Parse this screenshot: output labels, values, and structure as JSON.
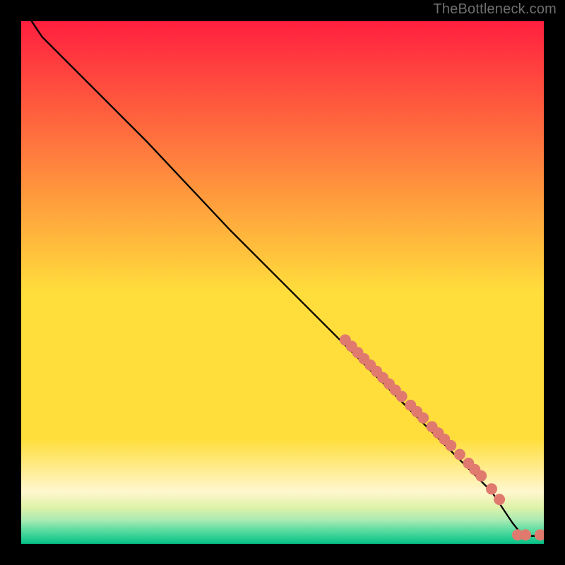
{
  "watermark": "TheBottleneck.com",
  "colors": {
    "marker": "#e07a6f",
    "curve": "#000000",
    "gradient_top": "#ff1f3f",
    "gradient_mid": "#ffde3c",
    "gradient_cream": "#fff7cf",
    "gradient_band1": "#dff2a8",
    "gradient_band2": "#a8ebb3",
    "gradient_band3": "#58dba0",
    "gradient_bottom": "#06c186"
  },
  "marker_radius": 8,
  "chart_data": {
    "type": "line",
    "title": "",
    "xlabel": "",
    "ylabel": "",
    "xlim": [
      0,
      100
    ],
    "ylim": [
      0,
      100
    ],
    "note": "Axes/tick labels not shown; values are visual estimates on a 0–100 scale where (0,100) is top-left of the colored area and (100,0) is bottom-right. Curve y decreases roughly linearly with x after an initial gentle bend. Markers are individual dots lying on or near the curve in the lower-right region.",
    "curve_points": [
      {
        "x": 2,
        "y": 100
      },
      {
        "x": 4,
        "y": 97
      },
      {
        "x": 8,
        "y": 93
      },
      {
        "x": 14,
        "y": 87
      },
      {
        "x": 24,
        "y": 77
      },
      {
        "x": 40,
        "y": 60
      },
      {
        "x": 56,
        "y": 44
      },
      {
        "x": 70,
        "y": 30
      },
      {
        "x": 82,
        "y": 18
      },
      {
        "x": 90,
        "y": 10
      },
      {
        "x": 94,
        "y": 4
      },
      {
        "x": 96,
        "y": 1.5
      },
      {
        "x": 100,
        "y": 1.5
      }
    ],
    "markers": [
      {
        "x": 62,
        "y": 39
      },
      {
        "x": 63.2,
        "y": 37.8
      },
      {
        "x": 64.4,
        "y": 36.6
      },
      {
        "x": 65.6,
        "y": 35.4
      },
      {
        "x": 66.8,
        "y": 34.2
      },
      {
        "x": 68.0,
        "y": 33.0
      },
      {
        "x": 69.2,
        "y": 31.8
      },
      {
        "x": 70.4,
        "y": 30.6
      },
      {
        "x": 71.6,
        "y": 29.4
      },
      {
        "x": 72.8,
        "y": 28.2
      },
      {
        "x": 74.5,
        "y": 26.5
      },
      {
        "x": 75.7,
        "y": 25.3
      },
      {
        "x": 76.9,
        "y": 24.1
      },
      {
        "x": 78.6,
        "y": 22.4
      },
      {
        "x": 79.8,
        "y": 21.2
      },
      {
        "x": 81.0,
        "y": 20.0
      },
      {
        "x": 82.2,
        "y": 18.8
      },
      {
        "x": 83.9,
        "y": 17.1
      },
      {
        "x": 85.6,
        "y": 15.4
      },
      {
        "x": 86.8,
        "y": 14.2
      },
      {
        "x": 88.0,
        "y": 13.0
      },
      {
        "x": 90.0,
        "y": 10.5
      },
      {
        "x": 91.5,
        "y": 8.5
      },
      {
        "x": 95.0,
        "y": 1.7
      },
      {
        "x": 96.5,
        "y": 1.7
      },
      {
        "x": 99.3,
        "y": 1.7
      },
      {
        "x": 100.5,
        "y": 1.7
      }
    ]
  }
}
